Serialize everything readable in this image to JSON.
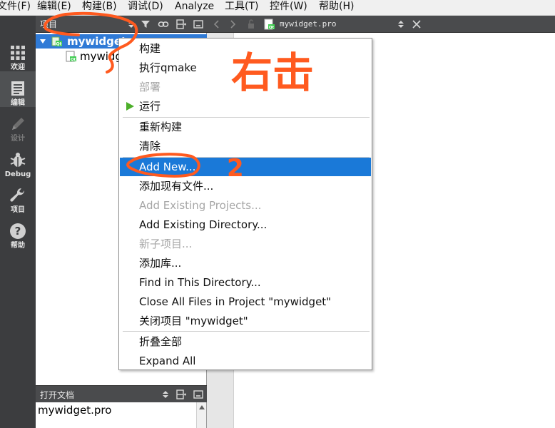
{
  "menubar": {
    "items": [
      "文件(F)",
      "编辑(E)",
      "构建(B)",
      "调试(D)",
      "Analyze",
      "工具(T)",
      "控件(W)",
      "帮助(H)"
    ]
  },
  "modebar": {
    "items": [
      {
        "label": "欢迎",
        "icon": "grid-icon"
      },
      {
        "label": "编辑",
        "icon": "document-icon",
        "active": true
      },
      {
        "label": "设计",
        "icon": "pencil-icon",
        "disabled": true
      },
      {
        "label": "Debug",
        "icon": "bug-icon"
      },
      {
        "label": "项目",
        "icon": "wrench-icon"
      },
      {
        "label": "帮助",
        "icon": "help-icon"
      }
    ]
  },
  "project_pane": {
    "title": "项目",
    "tree": {
      "root": "mywidget",
      "child": "mywidg"
    }
  },
  "open_documents": {
    "title": "打开文档",
    "items": [
      "mywidget.pro"
    ]
  },
  "editor": {
    "file": "mywidget.pro"
  },
  "context_menu": {
    "items": {
      "build": "构建",
      "run_qmake": "执行qmake",
      "deploy": "部署",
      "run": "运行",
      "rebuild": "重新构建",
      "clean": "清除",
      "add_new": "Add New...",
      "add_existing_files": "添加现有文件...",
      "add_existing_projects": "Add Existing Projects...",
      "add_existing_directory": "Add Existing Directory...",
      "new_subproject": "新子项目...",
      "add_library": "添加库...",
      "find_in_directory": "Find in This Directory...",
      "close_all_files": "Close All Files in Project \"mywidget\"",
      "close_project": "关闭项目 \"mywidget\"",
      "collapse_all": "折叠全部",
      "expand_all": "Expand All"
    }
  },
  "annotations": {
    "right_click": "右击",
    "step_two": "2"
  },
  "colors": {
    "highlight": "#1a79d8",
    "annotation": "#ff5a1f",
    "run_arrow": "#4caf2a"
  }
}
